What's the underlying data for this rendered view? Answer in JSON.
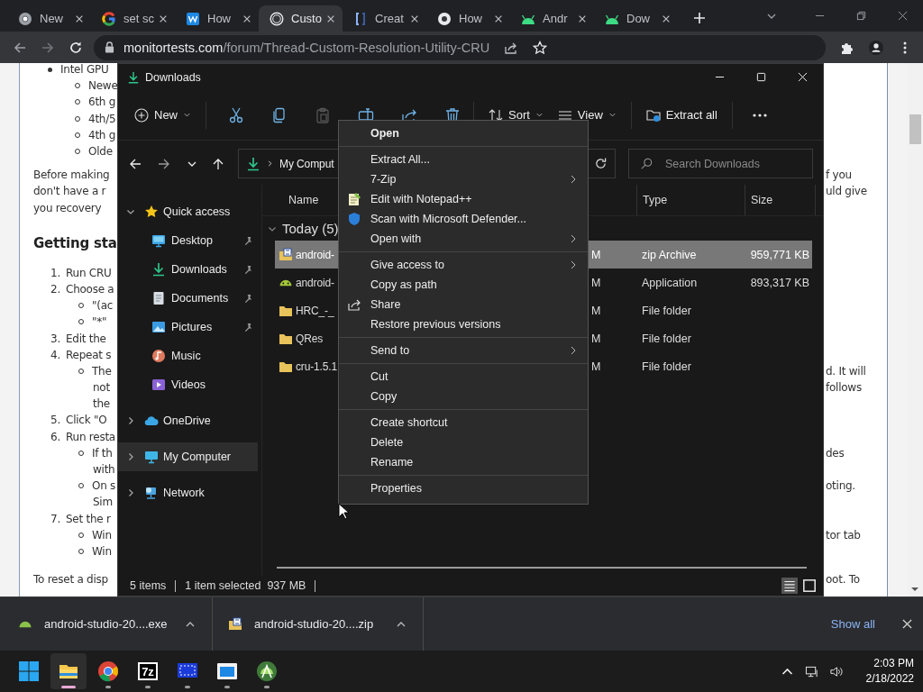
{
  "browser": {
    "tabs": [
      {
        "title": "New",
        "selected": false
      },
      {
        "title": "set sc",
        "selected": false
      },
      {
        "title": "How",
        "selected": false
      },
      {
        "title": "Custo",
        "selected": true
      },
      {
        "title": "Creat",
        "selected": false
      },
      {
        "title": "How",
        "selected": false
      },
      {
        "title": "Andr",
        "selected": false
      },
      {
        "title": "Dow",
        "selected": false
      }
    ],
    "url": {
      "host": "monitortests.com",
      "path": "/forum/Thread-Custom-Resolution-Utility-CRU"
    }
  },
  "web_page": {
    "blocks": [
      {
        "kind": "list",
        "lines": [
          {
            "kind": "bullet",
            "text": "Intel GPU"
          },
          {
            "kind": "circle",
            "text": "Newe"
          },
          {
            "kind": "circle",
            "text": "6th g"
          },
          {
            "kind": "circle",
            "text": "4th/5"
          },
          {
            "kind": "circle",
            "text": "4th g"
          },
          {
            "kind": "circle",
            "text": "Olde"
          }
        ]
      },
      {
        "kind": "paragraph",
        "lines": [
          {
            "text": "Before making",
            "right": "f you"
          },
          {
            "text": "don't have a r",
            "right": "uld give"
          },
          {
            "text": "you recovery"
          }
        ]
      },
      {
        "kind": "heading",
        "lines": [
          {
            "text": "Getting sta"
          }
        ]
      },
      {
        "kind": "list",
        "lines": [
          {
            "kind": "number",
            "marker": "1.",
            "text": "Run CRU"
          },
          {
            "kind": "number",
            "marker": "2.",
            "text": "Choose a"
          },
          {
            "kind": "circle",
            "text": "\"(ac"
          },
          {
            "kind": "circle",
            "text": "\"*\""
          },
          {
            "kind": "number",
            "marker": "3.",
            "text": "Edit the"
          },
          {
            "kind": "number",
            "marker": "4.",
            "text": "Repeat s"
          },
          {
            "kind": "circle",
            "text": "The",
            "right": "d. It will"
          },
          {
            "kind": "cont",
            "text": "not",
            "right": "follows"
          },
          {
            "kind": "cont",
            "text": "the"
          },
          {
            "kind": "number",
            "marker": "5.",
            "text": "Click \"O"
          },
          {
            "kind": "number",
            "marker": "6.",
            "text": "Run resta"
          },
          {
            "kind": "circle",
            "text": "If th",
            "right": "des"
          },
          {
            "kind": "cont",
            "text": "with"
          },
          {
            "kind": "circle",
            "text": "On s",
            "right": "oting."
          },
          {
            "kind": "cont",
            "text": "Sim"
          },
          {
            "kind": "number",
            "marker": "7.",
            "text": "Set the r"
          },
          {
            "kind": "circle",
            "text": "Win",
            "right": "tor tab"
          },
          {
            "kind": "circle",
            "text": "Win"
          }
        ]
      },
      {
        "kind": "paragraph",
        "lines": [
          {
            "text": "To reset a disp",
            "right": "oot. To"
          }
        ]
      }
    ]
  },
  "explorer": {
    "title": "Downloads",
    "toolbar": {
      "new": "New",
      "actions": [
        {
          "disabled": false
        },
        {
          "disabled": false
        },
        {
          "disabled": true
        },
        {
          "disabled": false
        },
        {
          "disabled": false
        },
        {
          "disabled": false
        }
      ],
      "sort": "Sort",
      "view": "View",
      "extract": "Extract all"
    },
    "breadcrumb": "My Comput",
    "search": {
      "placeholder": "Search Downloads"
    },
    "nav": [
      {
        "label": "Quick access",
        "expanded": true,
        "selected": false,
        "children": [
          {
            "label": "Desktop",
            "pinned": true,
            "selected": false
          },
          {
            "label": "Downloads",
            "pinned": true,
            "selected": false
          },
          {
            "label": "Documents",
            "pinned": true,
            "selected": false
          },
          {
            "label": "Pictures",
            "pinned": true,
            "selected": false
          },
          {
            "label": "Music",
            "pinned": false,
            "selected": false
          },
          {
            "label": "Videos",
            "pinned": false,
            "selected": false
          }
        ]
      },
      {
        "label": "OneDrive",
        "expanded": false,
        "selected": false
      },
      {
        "label": "My Computer",
        "expanded": false,
        "selected": true
      },
      {
        "label": "Network",
        "expanded": false,
        "selected": false
      }
    ],
    "columns": [
      "Name",
      "Type",
      "Size"
    ],
    "group": "Today (5)",
    "rows": [
      {
        "kind": "archive",
        "name": "android-",
        "date": "M",
        "type": "zip Archive",
        "size": "959,771 KB",
        "selected": true
      },
      {
        "kind": "app",
        "name": "android-",
        "date": "M",
        "type": "Application",
        "size": "893,317 KB",
        "selected": false
      },
      {
        "kind": "folder",
        "name": "HRC_-_",
        "date": "M",
        "type": "File folder",
        "selected": false
      },
      {
        "kind": "folder",
        "name": "QRes",
        "date": "M",
        "type": "File folder",
        "selected": false
      },
      {
        "kind": "folder",
        "name": "cru-1.5.1",
        "date": "M",
        "type": "File folder",
        "selected": false
      }
    ],
    "status": [
      "5 items",
      "1 item selected",
      "937 MB"
    ],
    "view_modes": [
      {
        "selected": true
      },
      {
        "selected": false
      }
    ]
  },
  "context_menu": {
    "sections": [
      [
        {
          "label": "Open",
          "default": true,
          "submenu": false
        }
      ],
      [
        {
          "label": "Extract All...",
          "default": false,
          "submenu": false
        },
        {
          "label": "7-Zip",
          "default": false,
          "submenu": true
        },
        {
          "label": "Edit with Notepad++",
          "default": false,
          "submenu": false
        },
        {
          "label": "Scan with Microsoft Defender...",
          "default": false,
          "submenu": false
        },
        {
          "label": "Open with",
          "default": false,
          "submenu": true
        }
      ],
      [
        {
          "label": "Give access to",
          "default": false,
          "submenu": true
        },
        {
          "label": "Copy as path",
          "default": false,
          "submenu": false
        },
        {
          "label": "Share",
          "default": false,
          "submenu": false
        },
        {
          "label": "Restore previous versions",
          "default": false,
          "submenu": false
        }
      ],
      [
        {
          "label": "Send to",
          "default": false,
          "submenu": true
        }
      ],
      [
        {
          "label": "Cut",
          "default": false,
          "submenu": false
        },
        {
          "label": "Copy",
          "default": false,
          "submenu": false
        }
      ],
      [
        {
          "label": "Create shortcut",
          "default": false,
          "submenu": false
        },
        {
          "label": "Delete",
          "default": false,
          "submenu": false
        },
        {
          "label": "Rename",
          "default": false,
          "submenu": false
        }
      ],
      [
        {
          "label": "Properties",
          "default": false,
          "submenu": false
        }
      ]
    ]
  },
  "downloads_bar": {
    "items": [
      "android-studio-20....exe",
      "android-studio-20....zip"
    ],
    "show_all": "Show all"
  },
  "taskbar": {
    "apps": [
      {
        "selected": true
      },
      {
        "selected": false
      },
      {
        "selected": false,
        "label": "7z"
      },
      {
        "selected": false
      },
      {
        "selected": false
      },
      {
        "selected": false
      }
    ],
    "time": "2:03 PM",
    "date": "2/18/2022"
  }
}
